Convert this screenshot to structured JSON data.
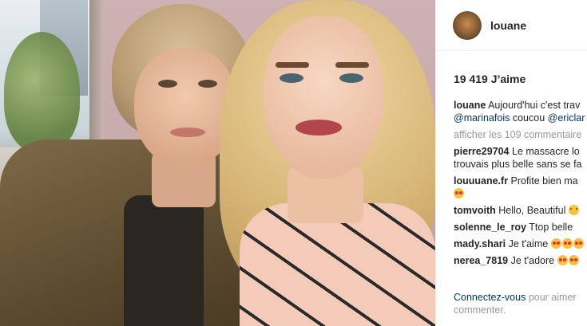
{
  "post": {
    "photo_alt": "selfie"
  },
  "header": {
    "username": "louane"
  },
  "likes": {
    "text": "19 419 J’aime"
  },
  "caption": {
    "user": "louane",
    "text": "Aujourd'hui c'est trav",
    "mention1": "@marinafois",
    "text2": "coucou",
    "mention2": "@ericlar"
  },
  "view_all": "afficher les 109 commentaire",
  "comments": [
    {
      "user": "pierre29704",
      "text": "Le massacre lo",
      "text_line2": "trouvais plus belle sans se fa"
    },
    {
      "user": "louuuane.fr",
      "text": "Profite bien ma",
      "emoji_line2": "heart-eyes"
    },
    {
      "user": "tomvoith",
      "text": "Hello, Beautiful",
      "emoji": "smile"
    },
    {
      "user": "solenne_le_roy",
      "text": "Ttop belle"
    },
    {
      "user": "mady.shari",
      "text": "Je t'aime",
      "emoji": "heart-eyes"
    },
    {
      "user": "nerea_7819",
      "text": "Je t'adore",
      "emoji": "heart-eyes"
    }
  ],
  "footer": {
    "login_link": "Connectez-vous",
    "text": "pour aimer",
    "text2": "commenter."
  }
}
